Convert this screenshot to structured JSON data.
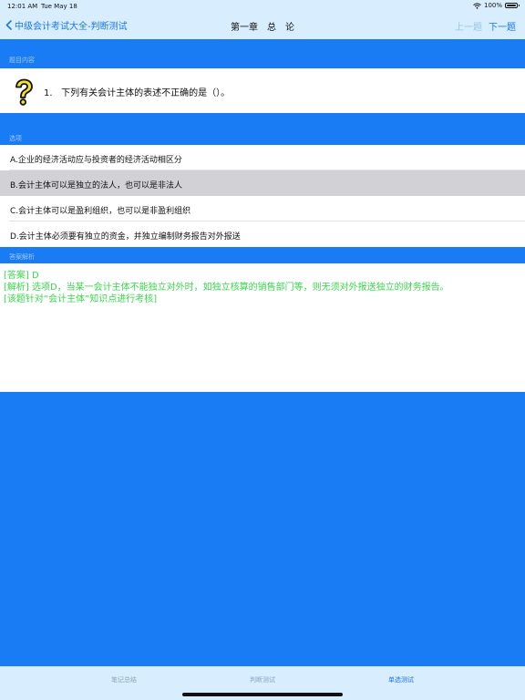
{
  "status_bar": {
    "time": "12:01 AM",
    "date": "Tue May 18",
    "battery": "100%",
    "icons": [
      "wifi-icon",
      "battery-icon"
    ]
  },
  "nav": {
    "back_label": "中级会计考试大全-判断测试",
    "title": "第一章　总　论",
    "prev_label": "上一题",
    "next_label": "下一题",
    "icons": [
      "chevron-left-icon"
    ]
  },
  "question": {
    "section_label": "题目内容",
    "number": "1.",
    "text": "下列有关会计主体的表述不正确的是（）。",
    "icon": "question-mark-icon"
  },
  "options": {
    "section_label": "选项",
    "items": [
      {
        "label": "A.企业的经济活动应与投资者的经济活动相区分",
        "selected": false
      },
      {
        "label": "B.会计主体可以是独立的法人，也可以是非法人",
        "selected": true
      },
      {
        "label": "C.会计主体可以是盈利组织，也可以是非盈利组织",
        "selected": false
      },
      {
        "label": "D.会计主体必须要有独立的资金，并独立编制财务报告对外报送",
        "selected": false
      }
    ]
  },
  "analysis": {
    "section_label": "答案解析",
    "answer_line": "[答案] D",
    "explanation_line": "[解析] 选项D，当某一会计主体不能独立对外时，如独立核算的销售部门等，则无须对外报送独立的财务报告。",
    "topic_line": "[该题针对“会计主体”知识点进行考核]"
  },
  "tabs": [
    {
      "label": "笔记总结",
      "active": false
    },
    {
      "label": "判断测试",
      "active": false
    },
    {
      "label": "单选测试",
      "active": true
    }
  ],
  "colors": {
    "background_blue": "#1a7cf4",
    "bar_light_blue": "#d8edfd",
    "accent_blue": "#1b78e8",
    "analysis_green": "#38d84b",
    "selected_gray": "#d1d1d6"
  }
}
